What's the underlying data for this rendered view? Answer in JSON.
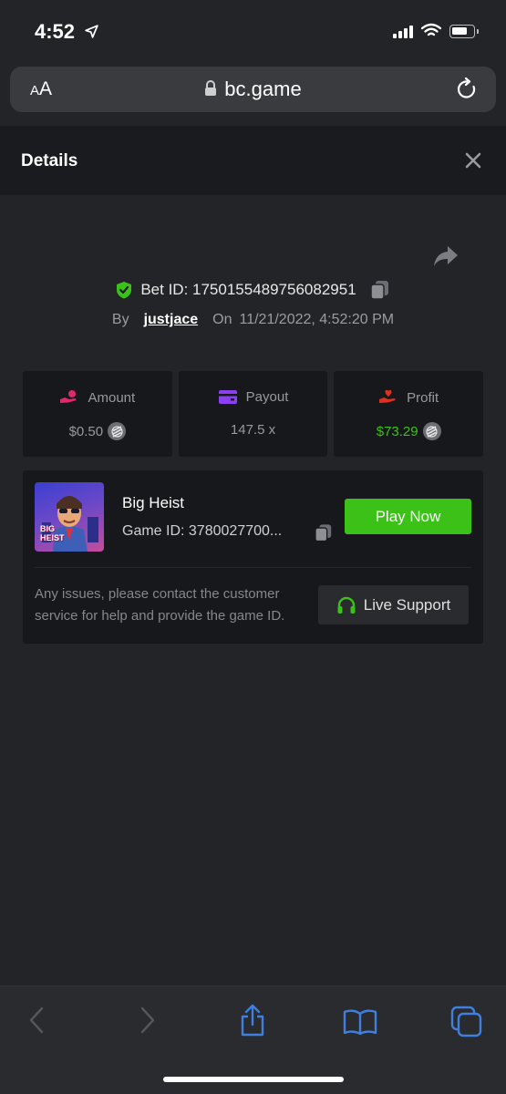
{
  "status_bar": {
    "time": "4:52"
  },
  "browser": {
    "text_size_small": "A",
    "text_size_big": "A",
    "url": "bc.game"
  },
  "details": {
    "title": "Details",
    "bet_id_label": "Bet ID: 1750155489756082951",
    "by_label": "By",
    "username": "justjace",
    "on_label": "On",
    "timestamp": "11/21/2022, 4:52:20 PM"
  },
  "stats": {
    "amount": {
      "label": "Amount",
      "value": "$0.50",
      "icon": "hand-coin-icon",
      "icon_color": "#e0296a"
    },
    "payout": {
      "label": "Payout",
      "value": "147.5 x",
      "icon": "card-icon",
      "icon_color": "#8b3ff0"
    },
    "profit": {
      "label": "Profit",
      "value": "$73.29",
      "icon": "hand-heart-icon",
      "icon_color": "#e0301e",
      "value_color": "#3bc117"
    }
  },
  "game": {
    "thumb_text_1": "BIG",
    "thumb_text_2": "HEIST",
    "name": "Big Heist",
    "game_id": "Game ID: 3780027700...",
    "play_label": "Play Now",
    "issue_text": "Any issues, please contact the customer service for help and provide the game ID.",
    "support_label": "Live Support"
  },
  "colors": {
    "accent_green": "#3bc117",
    "background": "#232427",
    "card": "#17181b",
    "toolbar_icon": "#3f7fe0"
  }
}
